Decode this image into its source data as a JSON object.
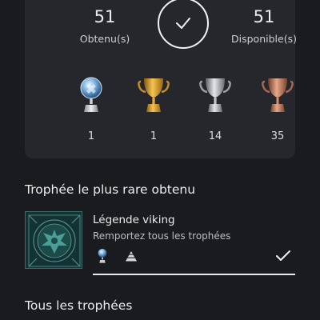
{
  "summary": {
    "earned_value": "51",
    "earned_label": "Obtenu(s)",
    "available_value": "51",
    "available_label": "Disponible(s)",
    "trophies": [
      {
        "type": "platinum-trophy-icon",
        "count": "1"
      },
      {
        "type": "gold-trophy-icon",
        "count": "1"
      },
      {
        "type": "silver-trophy-icon",
        "count": "14"
      },
      {
        "type": "bronze-trophy-icon",
        "count": "35"
      }
    ]
  },
  "rarest": {
    "section_title": "Trophée le plus rare obtenu",
    "name": "Légende viking",
    "description": "Remportez tous les trophées"
  },
  "all": {
    "section_title": "Tous les trophées"
  },
  "colors": {
    "background": "#1a1b1f",
    "card": "#26272c",
    "platinum": "#9fc4e8",
    "gold": "#d9a42c",
    "silver": "#b9bcc2",
    "bronze": "#c07a60"
  }
}
